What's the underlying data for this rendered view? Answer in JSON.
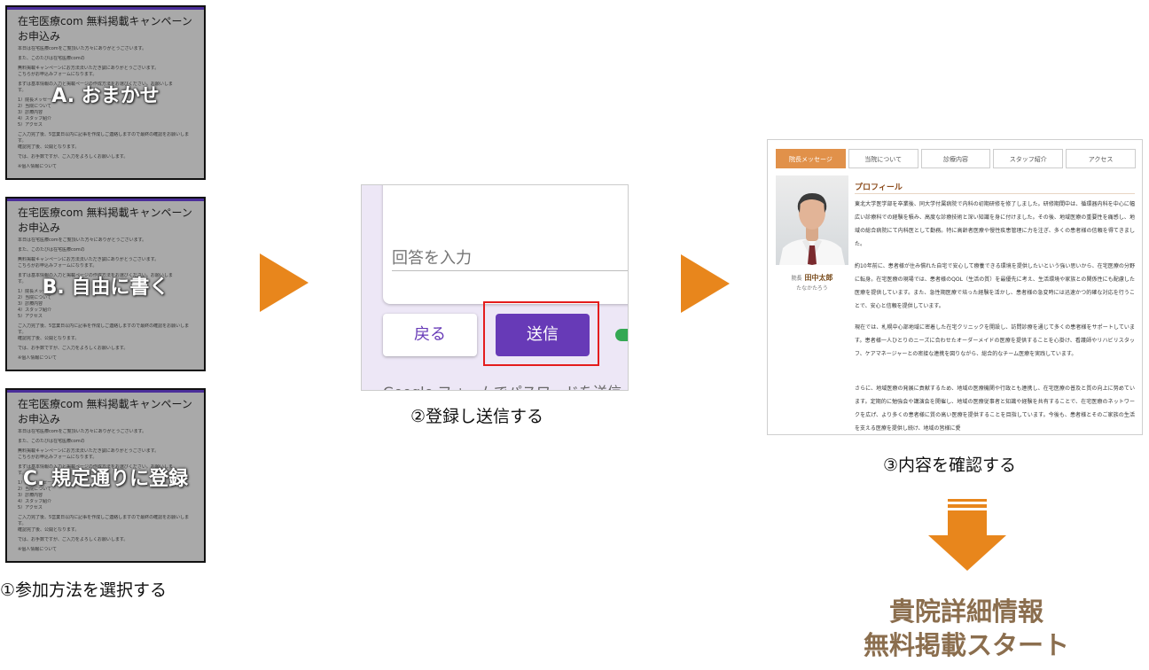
{
  "step1": {
    "form_title": "在宅医療com 無料掲載キャンペーンお申込み",
    "form_lines": [
      "本日は在宅医療comをご覧頂いた方々にありがとうございます。",
      "",
      "また、このたびは在宅医療comの",
      "",
      "無料掲載キャンペーンにお方法法いただき誠にありがとうございます。",
      "こちらがお申込みフォームになります。",
      "",
      "まずは基本情報の入力と掲載ページの作成方法をお選びください。お願いしま",
      "す。",
      "",
      "1）院長メッセージ",
      "2）当院について",
      "3）診療内容",
      "4）スタッフ紹介",
      "5）アクセス",
      "",
      "ご入力完了後、5営業日以内に記事を作成しご連絡しますので最終の確認をお願いしま",
      "す。",
      "確認完了後、公開となります。",
      "",
      "では、お手数ですが、ご入力をよろしくお願いします。",
      "",
      "※個人情報について"
    ],
    "options": [
      "A. おまかせ",
      "B. 自由に書く",
      "C. 規定通りに登録"
    ],
    "caption": "①参加方法を選択する"
  },
  "step2": {
    "answer_placeholder": "回答を入力",
    "back_label": "戻る",
    "send_label": "送信",
    "footer_text": "Google フォームでパスワードを送信",
    "caption": "②登録し送信する"
  },
  "step3": {
    "tabs": [
      "院長メッセージ",
      "当院について",
      "診療内容",
      "スタッフ紹介",
      "アクセス"
    ],
    "profile_title": "プロフィール",
    "doctor_role": "院長",
    "doctor_name": "田中太郎",
    "doctor_kana": "たなかたろう",
    "para1": "東北大学医学部を卒業後、同大学付属病院で内科の初期研修を修了しました。研修期間中は、循環器内科を中心に幅広い診療科での経験を積み、高度な診療技術と深い知識を身に付けました。その後、地域医療の重要性を痛感し、地域の総合病院にて内科医として勤務。特に高齢者医療や慢性疾患管理に力を注ぎ、多くの患者様の信頼を得てきました。",
    "para2": "約10年前に、患者様が住み慣れた自宅で安心して療養できる環境を提供したいという強い思いから、在宅医療の分野に転身。在宅医療の現場では、患者様のQOL（生活の質）を最優先に考え、生活環境や家族との関係性にも配慮した医療を提供しています。また、急性期医療で培った経験を活かし、患者様の急変時には迅速かつ的確な対応を行うことで、安心と信頼を提供しています。",
    "para3": "現在では、札幌中心部地域に密着した在宅クリニックを開設し、訪問診療を通じて多くの患者様をサポートしています。患者様一人ひとりのニーズに合わせたオーダーメイドの医療を提供することを心掛け、看護師やリハビリスタッフ、ケアマネージャーとの密接な連携を図りながら、総合的なチーム医療を実践しています。",
    "para4": "さらに、地域医療の発展に貢献するため、地域の医療機関や行政とも連携し、在宅医療の普及と質の向上に努めています。定期的に勉強会や講演会を開催し、地域の医療従事者と知識や経験を共有することで、在宅医療のネットワークを広げ、より多くの患者様に質の高い医療を提供することを目指しています。今後も、患者様とそのご家族の生活を支える医療を提供し続け、地域の皆様に愛",
    "caption": "③内容を確認する"
  },
  "result": {
    "line1": "貴院詳細情報",
    "line2": "無料掲載スタート"
  },
  "colors": {
    "accent_orange": "#e8861c",
    "form_purple": "#673ab7",
    "highlight_red": "#e41d1d",
    "result_brown": "#8b6e4e"
  }
}
